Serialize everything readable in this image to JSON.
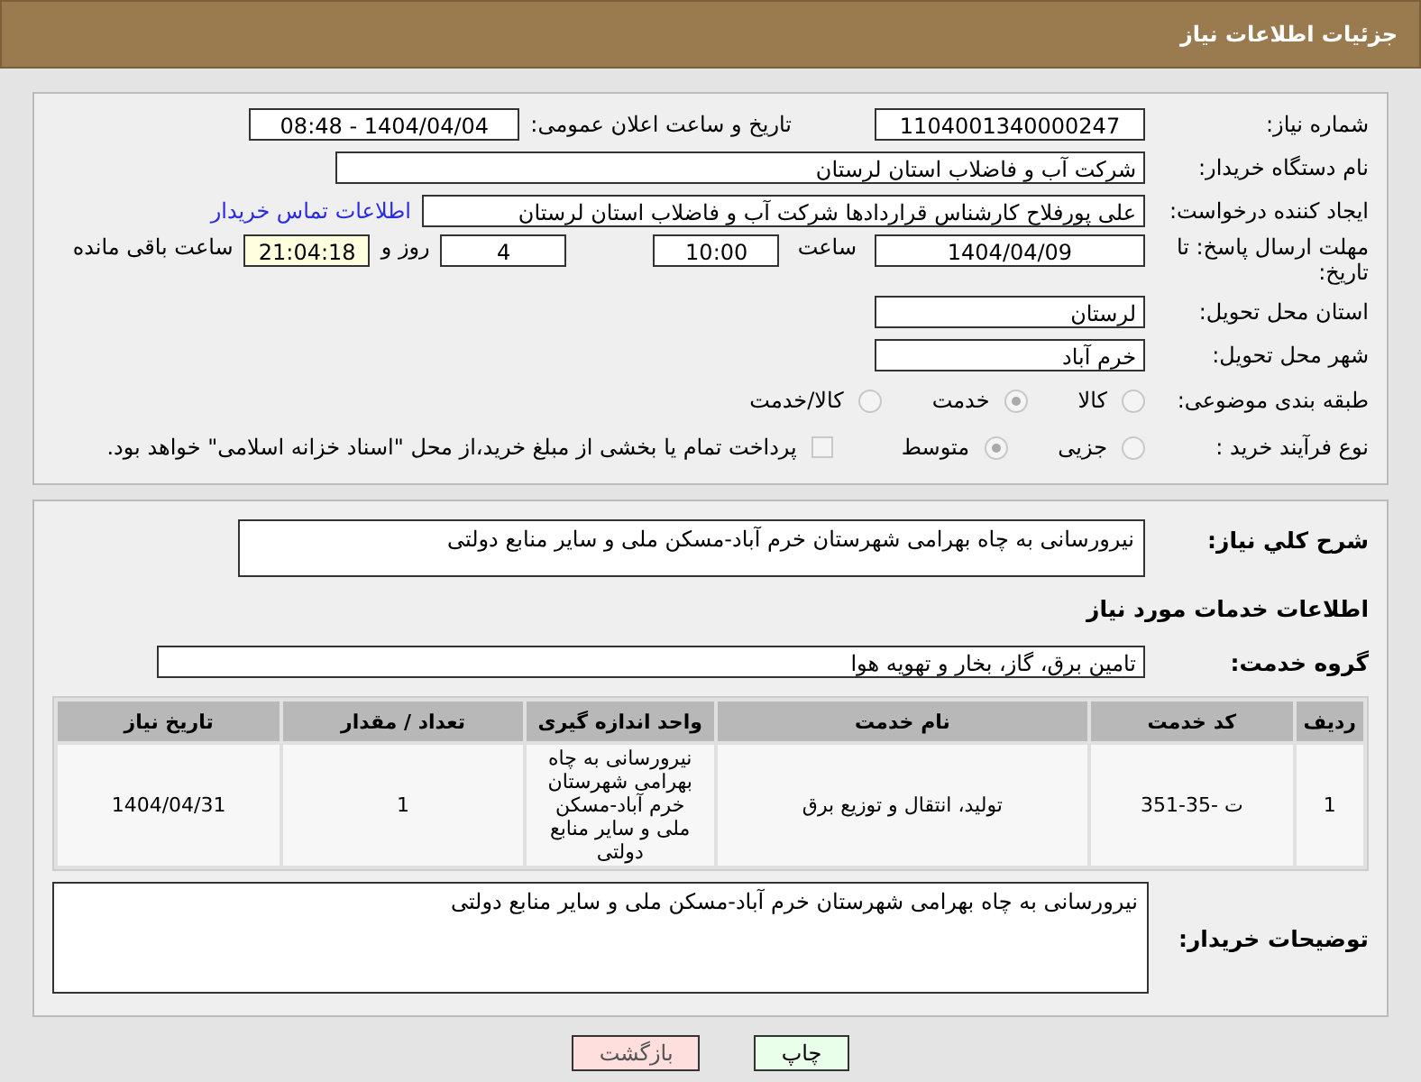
{
  "header": {
    "title": "جزئیات اطلاعات نیاز"
  },
  "need_number": {
    "label": "شماره نیاز:",
    "value": "1104001340000247"
  },
  "announce": {
    "label": "تاریخ و ساعت اعلان عمومی:",
    "value": "1404/04/04 - 08:48"
  },
  "buyer_org": {
    "label": "نام دستگاه خریدار:",
    "value": "شرکت آب و فاضلاب استان لرستان"
  },
  "requester": {
    "label": "ایجاد کننده درخواست:",
    "value": "علی پورفلاح کارشناس قراردادها شرکت آب و فاضلاب استان لرستان",
    "link": "اطلاعات تماس خریدار"
  },
  "deadline": {
    "label": "مهلت ارسال پاسخ: تا تاریخ:",
    "date": "1404/04/09",
    "time_label": "ساعت",
    "time": "10:00",
    "days": "4",
    "days_label": "روز و",
    "remaining": "21:04:18",
    "remaining_label": "ساعت باقی مانده"
  },
  "province": {
    "label": "استان محل تحویل:",
    "value": "لرستان"
  },
  "city": {
    "label": "شهر محل تحویل:",
    "value": "خرم آباد"
  },
  "category": {
    "label": "طبقه بندی موضوعی:",
    "options": [
      {
        "label": "کالا",
        "selected": false
      },
      {
        "label": "خدمت",
        "selected": true
      },
      {
        "label": "کالا/خدمت",
        "selected": false
      }
    ]
  },
  "purchase_type": {
    "label": "نوع فرآیند خرید :",
    "options": [
      {
        "label": "جزیی",
        "selected": false
      },
      {
        "label": "متوسط",
        "selected": true
      }
    ],
    "payment": {
      "checked": false,
      "label": "پرداخت تمام یا بخشی از مبلغ خرید،از محل \"اسناد خزانه اسلامی\" خواهد بود."
    }
  },
  "description": {
    "label": "شرح کلي نياز:",
    "value": "نیرورسانی به چاه بهرامی شهرستان خرم آباد-مسکن ملی و سایر منابع دولتی"
  },
  "services_title": "اطلاعات خدمات مورد نیاز",
  "service_group": {
    "label": "گروه خدمت:",
    "value": "تامین برق، گاز، بخار و تهویه هوا"
  },
  "table": {
    "columns": [
      "ردیف",
      "کد خدمت",
      "نام خدمت",
      "واحد اندازه گیری",
      "تعداد / مقدار",
      "تاریخ نیاز"
    ],
    "rows": [
      [
        "1",
        "ت -35-351",
        "تولید، انتقال و توزیع برق",
        "نیرورسانی به چاه بهرامی شهرستان خرم آباد-مسکن ملی و سایر منابع دولتی",
        "1",
        "1404/04/31"
      ]
    ]
  },
  "buyer_notes": {
    "label": "توضیحات خریدار:",
    "value": "نیرورسانی به چاه بهرامی شهرستان خرم آباد-مسکن ملی و سایر منابع دولتی"
  },
  "buttons": [
    {
      "label": "چاپ",
      "kind": "print"
    },
    {
      "label": "بازگشت",
      "kind": "back"
    }
  ]
}
